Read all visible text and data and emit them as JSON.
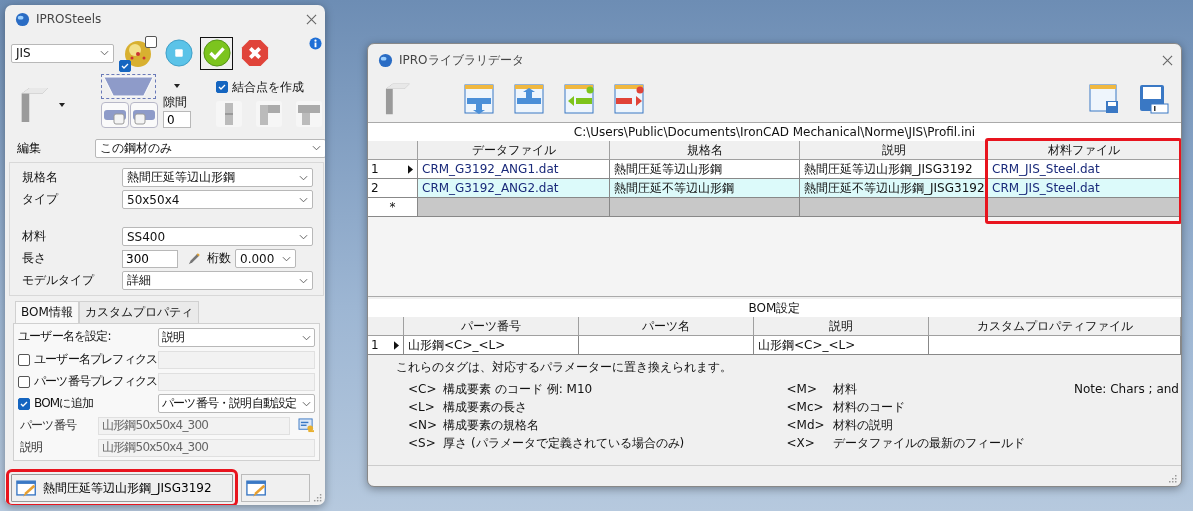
{
  "steels_window": {
    "title": "IPROSteels",
    "standard": "JIS",
    "view_checks": [
      {
        "checked": true
      },
      {
        "checked": false
      }
    ],
    "action_buttons": [
      {
        "kind": "stop",
        "selected": false
      },
      {
        "kind": "ok",
        "selected": true
      },
      {
        "kind": "cancel",
        "selected": false
      }
    ],
    "create_joint": {
      "label": "結合点を作成",
      "checked": true
    },
    "gap": {
      "label": "隙間",
      "value": "0"
    },
    "edit": {
      "label": "編集",
      "value": "この鋼材のみ"
    },
    "profile_props": [
      {
        "label": "規格名",
        "value": "熱間圧延等辺山形鋼"
      },
      {
        "label": "タイプ",
        "value": "50x50x4"
      }
    ],
    "material_props": [
      {
        "kind": "select",
        "label": "材料",
        "value": "SS400"
      },
      {
        "kind": "length",
        "label": "長さ",
        "value": "300",
        "digits_label": "桁数",
        "digits": "0.000"
      },
      {
        "kind": "select",
        "label": "モデルタイプ",
        "value": "詳細"
      }
    ],
    "tabs": [
      {
        "label": "BOM情報",
        "selected": true
      },
      {
        "label": "カスタムプロパティ",
        "selected": false
      }
    ],
    "user_name": {
      "label": "ユーザー名を設定:",
      "value": "説明"
    },
    "options": [
      {
        "kind": "text",
        "label": "ユーザー名プレフィクス",
        "checked": false
      },
      {
        "kind": "text",
        "label": "パーツ番号プレフィクス",
        "checked": false
      },
      {
        "kind": "select",
        "label": "BOMに追加",
        "checked": true,
        "value": "パーツ番号・説明自動設定"
      }
    ],
    "part_number": {
      "label": "パーツ番号",
      "value": "山形鋼50x50x4_300"
    },
    "description": {
      "label": "説明",
      "value": "山形鋼50x50x4_300"
    },
    "profile_button": {
      "label": "熱間圧延等辺山形鋼_JISG3192",
      "highlighted": true
    }
  },
  "library_window": {
    "title": "IPROライブラリデータ",
    "path": "C:\\Users\\Public\\Documents\\IronCAD Mechanical\\Norme\\JIS\\Profil.ini",
    "columns": [
      {
        "label": "データファイル",
        "highlighted": false
      },
      {
        "label": "規格名",
        "highlighted": false
      },
      {
        "label": "説明",
        "highlighted": false
      },
      {
        "label": "材料ファイル",
        "highlighted": true
      }
    ],
    "rows": [
      {
        "number": "1",
        "current": true,
        "selected": false,
        "cells": [
          "CRM_G3192_ANG1.dat",
          "熱間圧延等辺山形鋼",
          "熱間圧延等辺山形鋼_JISG3192",
          "CRM_JIS_Steel.dat"
        ]
      },
      {
        "number": "2",
        "current": false,
        "selected": true,
        "cells": [
          "CRM_G3192_ANG2.dat",
          "熱間圧延不等辺山形鋼",
          "熱間圧延不等辺山形鋼_JISG3192",
          "CRM_JIS_Steel.dat"
        ]
      }
    ],
    "new_row_marker": "*",
    "bom_title": "BOM設定",
    "bom_columns": [
      {
        "label": "パーツ番号"
      },
      {
        "label": "パーツ名"
      },
      {
        "label": "説明"
      },
      {
        "label": "カスタムプロパティファイル"
      }
    ],
    "bom_rows": [
      {
        "number": "1",
        "current": true,
        "cells": [
          {
            "text": "山形鋼<C>_<L>"
          },
          {},
          {
            "text": "山形鋼<C>_<L>"
          },
          {}
        ]
      }
    ],
    "tag_intro": "これらのタグは、対応するパラメーターに置き換えられます。",
    "tags_left": [
      {
        "tag": "<C>",
        "meaning": "構成要素 のコード 例: M10"
      },
      {
        "tag": "<L>",
        "meaning": "構成要素の長さ"
      },
      {
        "tag": "<N>",
        "meaning": "構成要素の規格名"
      },
      {
        "tag": "<S>",
        "meaning": "厚さ (パラメータで定義されている場合のみ)"
      }
    ],
    "tags_right": [
      {
        "tag": "<M>",
        "meaning": "材料"
      },
      {
        "tag": "<Mc>",
        "meaning": "材料のコード"
      },
      {
        "tag": "<Md>",
        "meaning": "材料の説明"
      },
      {
        "tag": "<X>",
        "meaning": "データファイルの最新のフィールド"
      }
    ],
    "note": "Note: Chars ; and"
  }
}
